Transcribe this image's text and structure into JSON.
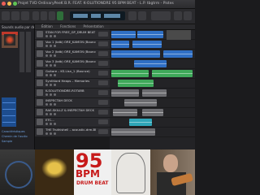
{
  "window": {
    "title": "Projet TVD OrdinaryPeeK B.R. FEAT. K-OLUTIONDRE 95 BPM BEAT - L.P. tbgtrm - Pistes"
  },
  "browser": {
    "header": "Sounds audio par défaut",
    "labels": [
      "Caractéristiques",
      "Chemin de l'audio",
      "Sample"
    ]
  },
  "tracks_header": {
    "items": [
      "Édition",
      "Fonctions",
      "Présentation"
    ]
  },
  "tracks": [
    {
      "name": "STAN FOR FREE_GP_DRUM BEAT"
    },
    {
      "name": "Vox 1 (bdb) ORE_KAMON (Bounce)"
    },
    {
      "name": "Vox 2 (bdb) ORE_KAMON (Bounce)"
    },
    {
      "name": "Vox 3 (bdb) ORE_KAMON (Bounce)"
    },
    {
      "name": "Guitare – KS.Lisn_1 (Bounce)"
    },
    {
      "name": "Synthlord Heaps – Memories"
    },
    {
      "name": "K-SOLUTIONDRE-ROTARB"
    },
    {
      "name": "INSPECTAH DECK"
    },
    {
      "name": "RAE-SKILLZ & INSPECTAH DECK"
    },
    {
      "name": "ETC..."
    },
    {
      "name": "THE Truthishell – acoustic-drm-BPM"
    }
  ],
  "bottom_images": {
    "cover_bpm_number": "95",
    "cover_bpm_unit": "BPM",
    "cover_sub": "DRUM BEAT"
  },
  "colors": {
    "accent_blue": "#2f6fc4",
    "accent_green": "#3fa85a",
    "bpm_red": "#c71a1a"
  }
}
